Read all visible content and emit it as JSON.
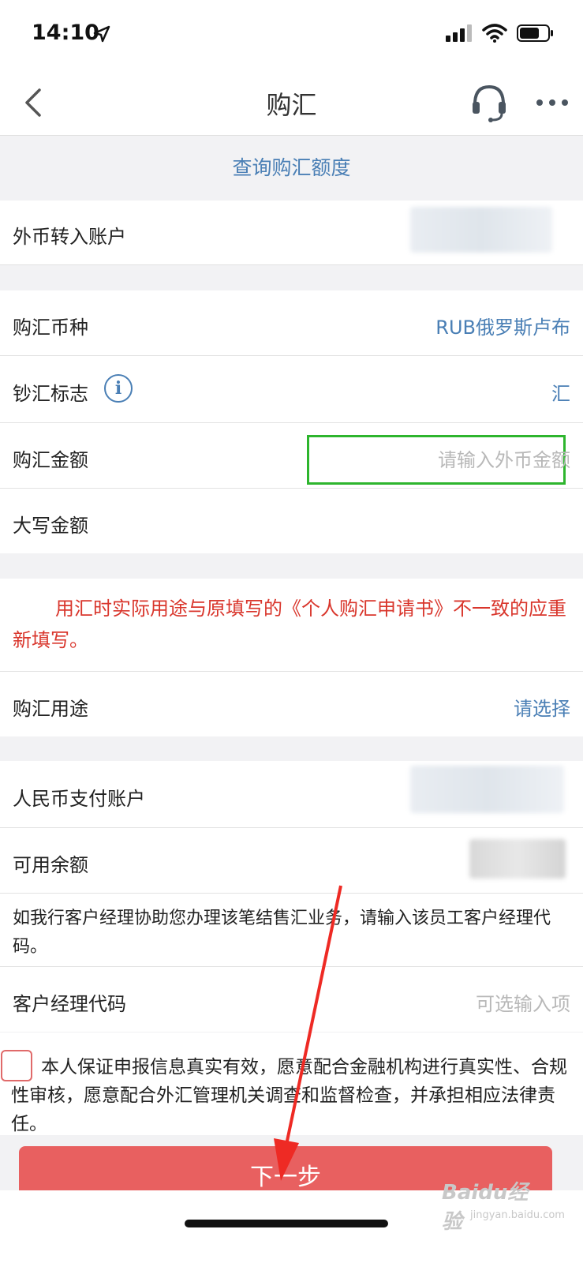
{
  "status": {
    "time": "14:10"
  },
  "nav": {
    "title": "购汇"
  },
  "query_link": "查询购汇额度",
  "fields": {
    "foreign_account": {
      "label": "外币转入账户"
    },
    "currency": {
      "label": "购汇币种",
      "value": "RUB俄罗斯卢布"
    },
    "cash_flag": {
      "label": "钞汇标志",
      "value": "汇"
    },
    "amount": {
      "label": "购汇金额",
      "placeholder": "请输入外币金额"
    },
    "amount_upper": {
      "label": "大写金额"
    },
    "purpose": {
      "label": "购汇用途",
      "value": "请选择"
    },
    "rmb_account": {
      "label": "人民币支付账户"
    },
    "balance": {
      "label": "可用余额"
    },
    "manager_code": {
      "label": "客户经理代码",
      "placeholder": "可选输入项"
    }
  },
  "notice": "用汇时实际用途与原填写的《个人购汇申请书》不一致的应重新填写。",
  "manager_hint": "如我行客户经理协助您办理该笔结售汇业务，请输入该员工客户经理代码。",
  "agreement": "本人保证申报信息真实有效，愿意配合金融机构进行真实性、合规性审核，愿意配合外汇管理机关调查和监督检查，并承担相应法律责任。",
  "next_button": "下一步",
  "watermark": {
    "brand": "Baidu经验",
    "url": "jingyan.baidu.com"
  },
  "colors": {
    "link_blue": "#4a7fb5",
    "notice_red": "#d9362c",
    "button_red": "#e86060",
    "highlight_green": "#2db52d"
  }
}
